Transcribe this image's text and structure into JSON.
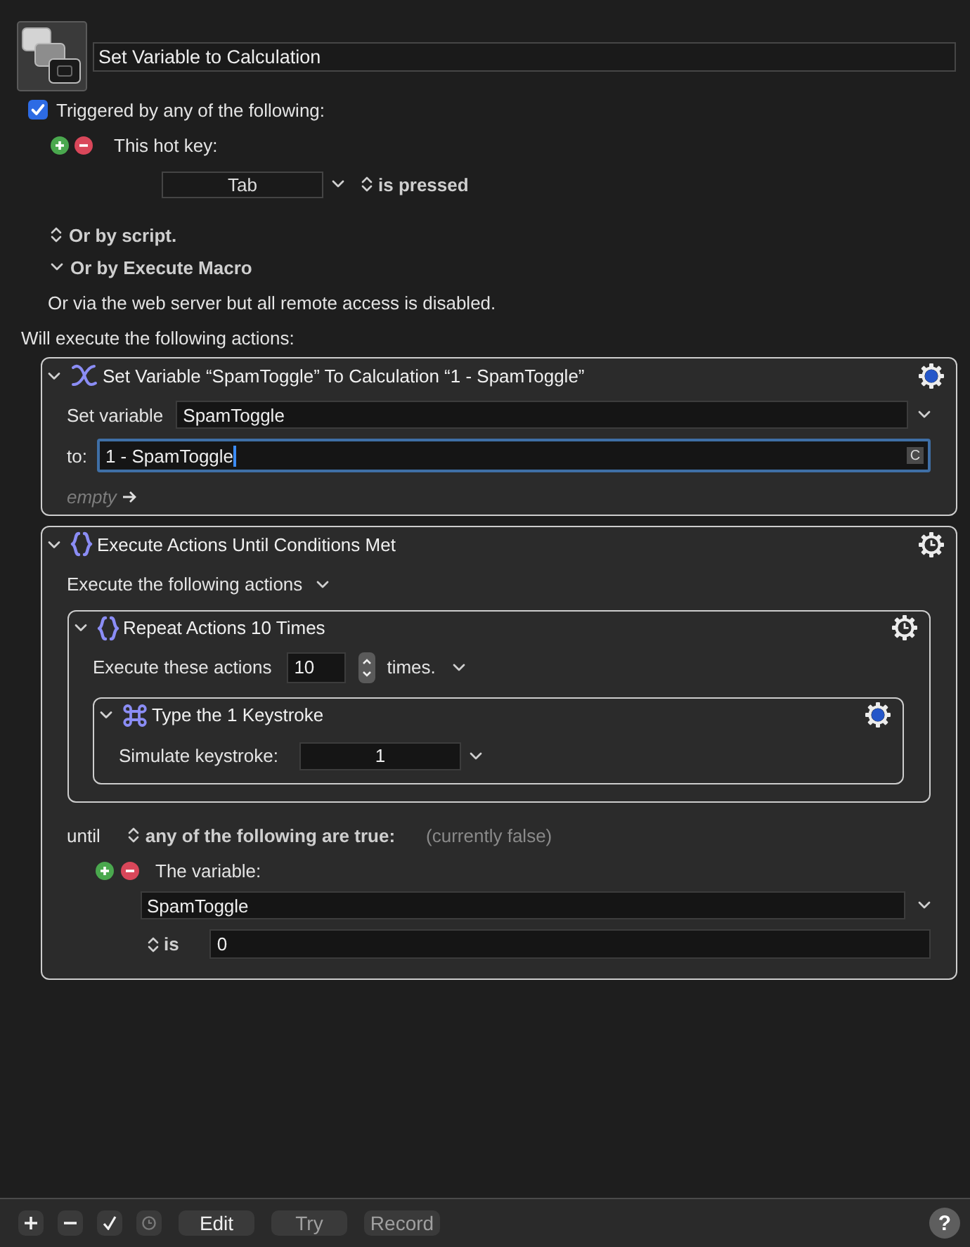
{
  "macro": {
    "name": "Set Variable to Calculation"
  },
  "trigger": {
    "checked": true,
    "label": "Triggered by any of the following:",
    "items": [
      {
        "kind": "hotkey",
        "label": "This hot key:",
        "key": "Tab",
        "condition": "is pressed"
      }
    ]
  },
  "options": [
    {
      "kind": "stepper",
      "label": "Or by script."
    },
    {
      "kind": "menu",
      "label": "Or by Execute Macro"
    }
  ],
  "web_note": "Or via the web server but all remote access is disabled.",
  "actions_heading": "Will execute the following actions:",
  "actions": [
    {
      "kind": "set_variable",
      "title": "Set Variable “SpamToggle” To Calculation “1 - SpamToggle”",
      "expanded": true,
      "variable_label": "Set variable",
      "variable": "SpamToggle",
      "to_label": "to:",
      "to_value": "1 - SpamToggle",
      "to_focused": true,
      "to_badge": "C",
      "result": "empty"
    },
    {
      "kind": "until",
      "title": "Execute Actions Until Conditions Met",
      "expanded": true,
      "subtitle": "Execute the following actions",
      "children": [
        {
          "kind": "repeat",
          "title": "Repeat Actions 10 Times",
          "expanded": true,
          "label": "Execute these actions",
          "count": "10",
          "suffix": "times.",
          "children": [
            {
              "kind": "keystroke",
              "title": "Type the 1 Keystroke",
              "expanded": true,
              "label": "Simulate keystroke:",
              "key": "1"
            }
          ]
        }
      ],
      "until_label": "until",
      "mode": "any of the following are true:",
      "status": "(currently false)",
      "conditions": [
        {
          "kind": "variable",
          "label": "The variable:",
          "variable": "SpamToggle",
          "operator": "is",
          "value": "0"
        }
      ]
    }
  ],
  "toolbar": {
    "icon_buttons": [
      {
        "kind": "add",
        "disabled": false
      },
      {
        "kind": "remove",
        "disabled": false
      },
      {
        "kind": "check",
        "disabled": false
      },
      {
        "kind": "clock",
        "disabled": true
      }
    ],
    "buttons": [
      {
        "label": "Edit",
        "disabled": false
      },
      {
        "label": "Try",
        "disabled": true
      },
      {
        "label": "Record",
        "disabled": true
      }
    ],
    "help": "?"
  }
}
